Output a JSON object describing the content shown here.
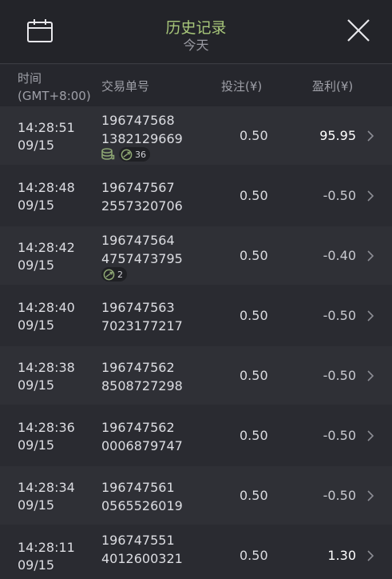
{
  "header": {
    "title": "历史记录",
    "subtitle": "今天",
    "calendar_icon": "calendar-icon",
    "close_icon": "close-icon"
  },
  "columns": {
    "time_line1": "时间",
    "time_line2": "(GMT+8:00)",
    "order": "交易单号",
    "bet": "投注(¥)",
    "profit": "盈利(¥)"
  },
  "rows": [
    {
      "time": "14:28:51",
      "date": "09/15",
      "order1": "196747568",
      "order2": "1382129669",
      "bet": "0.50",
      "profit": "95.95",
      "win": true,
      "coins": true,
      "ball_count": "36"
    },
    {
      "time": "14:28:48",
      "date": "09/15",
      "order1": "196747567",
      "order2": "2557320706",
      "bet": "0.50",
      "profit": "-0.50",
      "win": false
    },
    {
      "time": "14:28:42",
      "date": "09/15",
      "order1": "196747564",
      "order2": "4757473795",
      "bet": "0.50",
      "profit": "-0.40",
      "win": false,
      "ball_count": "2"
    },
    {
      "time": "14:28:40",
      "date": "09/15",
      "order1": "196747563",
      "order2": "7023177217",
      "bet": "0.50",
      "profit": "-0.50",
      "win": false
    },
    {
      "time": "14:28:38",
      "date": "09/15",
      "order1": "196747562",
      "order2": "8508727298",
      "bet": "0.50",
      "profit": "-0.50",
      "win": false
    },
    {
      "time": "14:28:36",
      "date": "09/15",
      "order1": "196747562",
      "order2": "0006879747",
      "bet": "0.50",
      "profit": "-0.50",
      "win": false
    },
    {
      "time": "14:28:34",
      "date": "09/15",
      "order1": "196747561",
      "order2": "0565526019",
      "bet": "0.50",
      "profit": "-0.50",
      "win": false
    },
    {
      "time": "14:28:11",
      "date": "09/15",
      "order1": "196747551",
      "order2": "4012600321",
      "bet": "0.50",
      "profit": "1.30",
      "win": true
    }
  ],
  "colors": {
    "title": "#a8c77a",
    "background": "#2a2b31",
    "row_alt": "#2f3036",
    "header_bg": "#232429"
  }
}
